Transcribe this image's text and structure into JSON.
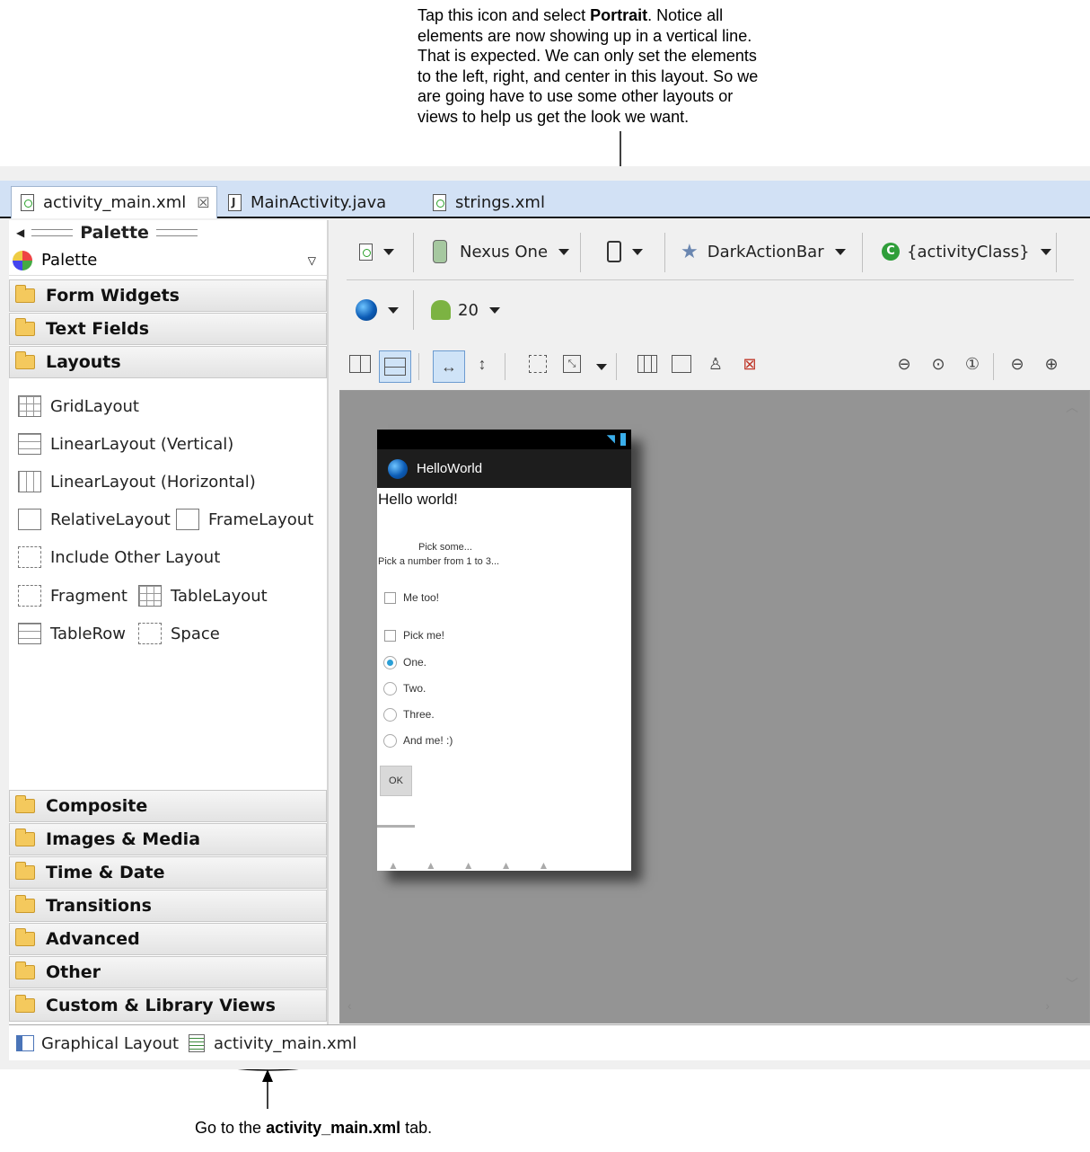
{
  "annotations": {
    "top": {
      "lines": [
        [
          "Tap this icon and select ",
          "Portrait",
          ". Notice all"
        ],
        [
          "elements are now showing up in a vertical line.",
          "",
          ""
        ],
        [
          "That is expected. We can only set the elements",
          "",
          ""
        ],
        [
          "to the left, right, and center in this layout. So we",
          "",
          ""
        ],
        [
          "are going have to use some other layouts or",
          "",
          ""
        ],
        [
          "views to help us get the look we want.",
          "",
          ""
        ]
      ]
    },
    "bottom": {
      "pre": "Go to the ",
      "bold": "activity_main.xml",
      "post": " tab."
    }
  },
  "editor_tabs": [
    {
      "label": "activity_main.xml",
      "active": true
    },
    {
      "label": "MainActivity.java",
      "active": false
    },
    {
      "label": "strings.xml",
      "active": false
    }
  ],
  "palette": {
    "header": "Palette",
    "selector": "Palette",
    "categories_top": [
      "Form Widgets",
      "Text Fields",
      "Layouts"
    ],
    "layout_items": [
      "GridLayout",
      "LinearLayout (Vertical)",
      "LinearLayout (Horizontal)",
      "RelativeLayout",
      "FrameLayout",
      "Include Other Layout",
      "Fragment",
      "TableLayout",
      "TableRow",
      "Space"
    ],
    "categories_bottom": [
      "Composite",
      "Images & Media",
      "Time & Date",
      "Transitions",
      "Advanced",
      "Other",
      "Custom & Library Views"
    ]
  },
  "toolbar": {
    "device": "Nexus One",
    "theme": "DarkActionBar",
    "activity": "{activityClass}",
    "api": "20"
  },
  "phone": {
    "app_title": "HelloWorld",
    "hello": "Hello world!",
    "pick1": "Pick some...",
    "pick2": "Pick a number from 1 to 3...",
    "checks": [
      "Me too!",
      "Pick me!"
    ],
    "radios": [
      "One.",
      "Two.",
      "Three.",
      "And me! :)"
    ],
    "ok": "OK"
  },
  "bottom_tabs": [
    "Graphical Layout",
    "activity_main.xml"
  ]
}
